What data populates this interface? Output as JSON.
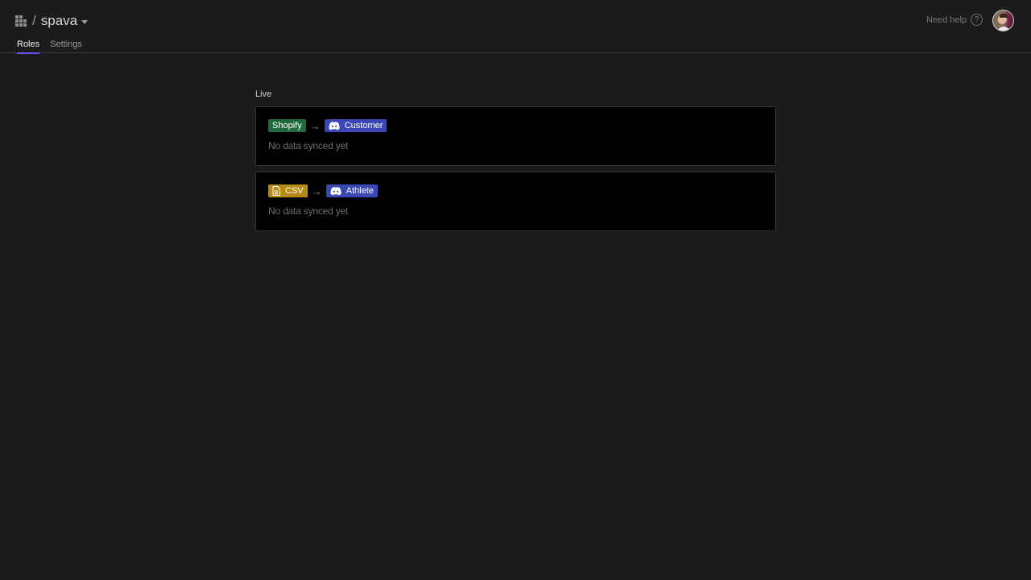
{
  "header": {
    "breadcrumb_separator": "/",
    "project_name": "spava",
    "help_label": "Need help",
    "help_icon_glyph": "?"
  },
  "tabs": [
    {
      "label": "Roles",
      "active": true
    },
    {
      "label": "Settings",
      "active": false
    }
  ],
  "main": {
    "section_label": "Live",
    "arrow_glyph": "→",
    "syncs": [
      {
        "source": {
          "label": "Shopify",
          "icon": null,
          "color": "#1f6b3b"
        },
        "target": {
          "label": "Customer",
          "icon": "discord-icon",
          "color": "#3c47b6"
        },
        "status": "No data synced yet"
      },
      {
        "source": {
          "label": "CSV",
          "icon": "file-icon",
          "color": "#b68a16"
        },
        "target": {
          "label": "Athlete",
          "icon": "discord-icon",
          "color": "#3c47b6"
        },
        "status": "No data synced yet"
      }
    ]
  },
  "colors": {
    "background": "#1b1b1d",
    "card_background": "#000000",
    "tab_active_underline": "#6b4cf5"
  }
}
